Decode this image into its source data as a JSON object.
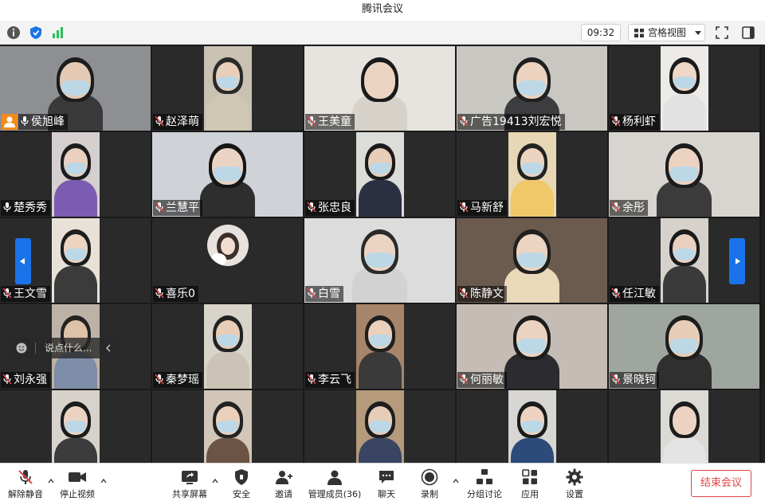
{
  "window": {
    "title": "腾讯会议"
  },
  "infobar": {
    "time": "09:32",
    "view_mode": "宫格视图",
    "icons": [
      "info-icon",
      "shield-icon",
      "signal-icon",
      "grid-icon",
      "fullscreen-icon",
      "sidebar-toggle-icon"
    ]
  },
  "participants": [
    {
      "name": "侯旭峰",
      "muted": false,
      "host": true
    },
    {
      "name": "赵泽萌",
      "muted": true
    },
    {
      "name": "王美童",
      "muted": true
    },
    {
      "name": "广告19413刘宏悦",
      "muted": true
    },
    {
      "name": "杨利虾",
      "muted": true
    },
    {
      "name": "楚秀秀",
      "muted": false
    },
    {
      "name": "兰慧平",
      "muted": true
    },
    {
      "name": "张忠良",
      "muted": true
    },
    {
      "name": "马新舒",
      "muted": true
    },
    {
      "name": "余彤",
      "muted": true
    },
    {
      "name": "王文雪",
      "muted": true
    },
    {
      "name": "喜乐0",
      "muted": true,
      "video_off": true
    },
    {
      "name": "白雪",
      "muted": true
    },
    {
      "name": "陈静文",
      "muted": true
    },
    {
      "name": "任江敏",
      "muted": true
    },
    {
      "name": "刘永强",
      "muted": true
    },
    {
      "name": "秦梦瑶",
      "muted": true
    },
    {
      "name": "李云飞",
      "muted": true
    },
    {
      "name": "何丽敏",
      "muted": true
    },
    {
      "name": "景晓钶",
      "muted": true
    },
    {
      "name": "",
      "muted": true
    },
    {
      "name": "",
      "muted": true
    },
    {
      "name": "",
      "muted": true
    },
    {
      "name": "",
      "muted": true
    },
    {
      "name": "",
      "muted": true
    }
  ],
  "chat": {
    "placeholder": "说点什么..."
  },
  "toolbar": {
    "unmute": "解除静音",
    "stop_video": "停止视频",
    "share_screen": "共享屏幕",
    "security": "安全",
    "invite": "邀请",
    "manage_members": "管理成员(36)",
    "chat": "聊天",
    "record": "录制",
    "breakout": "分组讨论",
    "apps": "应用",
    "settings": "设置",
    "end_meeting": "结束会议"
  },
  "colors": {
    "accent": "#1a73e8",
    "end": "#e04444",
    "signal": "#2bbf5a"
  }
}
